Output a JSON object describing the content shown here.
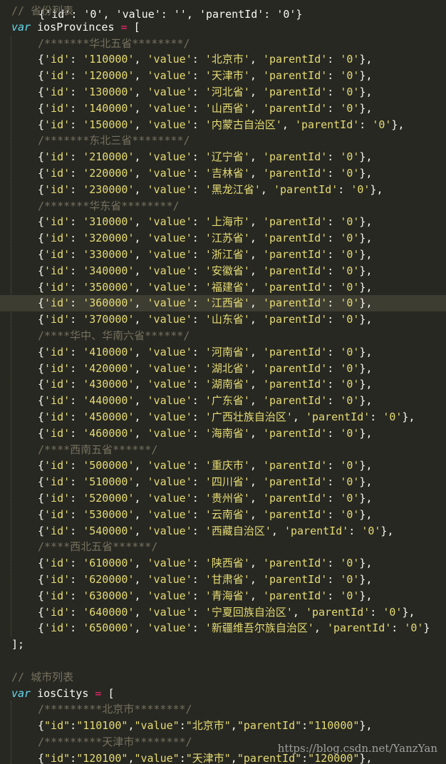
{
  "theme": {
    "background": "#272822",
    "comment": "#75715e",
    "keyword": "#66d9ef",
    "operator": "#f92672",
    "string": "#e6db74",
    "text": "#f8f8f2",
    "highlight_line": "#3e3d32"
  },
  "top_partial": "  {'id': '0', 'value': '', 'parentId': '0'}",
  "provinces_block": {
    "comment": "// 省份列表",
    "keyword": "var",
    "name": "iosProvinces",
    "opener": "= [",
    "groups": [
      {
        "comment": "/*******华北五省********/",
        "rows": [
          {
            "id": "110000",
            "value": "北京市"
          },
          {
            "id": "120000",
            "value": "天津市"
          },
          {
            "id": "130000",
            "value": "河北省"
          },
          {
            "id": "140000",
            "value": "山西省"
          },
          {
            "id": "150000",
            "value": "内蒙古自治区"
          }
        ]
      },
      {
        "comment": "/*******东北三省********/",
        "rows": [
          {
            "id": "210000",
            "value": "辽宁省"
          },
          {
            "id": "220000",
            "value": "吉林省"
          },
          {
            "id": "230000",
            "value": "黑龙江省"
          }
        ]
      },
      {
        "comment": "/*******华东省********/",
        "rows": [
          {
            "id": "310000",
            "value": "上海市"
          },
          {
            "id": "320000",
            "value": "江苏省"
          },
          {
            "id": "330000",
            "value": "浙江省"
          },
          {
            "id": "340000",
            "value": "安徽省"
          },
          {
            "id": "350000",
            "value": "福建省"
          },
          {
            "id": "360000",
            "value": "江西省",
            "highlight": true
          },
          {
            "id": "370000",
            "value": "山东省"
          }
        ]
      },
      {
        "comment": "/****华中、华南六省******/",
        "rows": [
          {
            "id": "410000",
            "value": "河南省"
          },
          {
            "id": "420000",
            "value": "湖北省"
          },
          {
            "id": "430000",
            "value": "湖南省"
          },
          {
            "id": "440000",
            "value": "广东省"
          },
          {
            "id": "450000",
            "value": "广西壮族自治区"
          },
          {
            "id": "460000",
            "value": "海南省"
          }
        ]
      },
      {
        "comment": "/****西南五省******/",
        "rows": [
          {
            "id": "500000",
            "value": "重庆市"
          },
          {
            "id": "510000",
            "value": "四川省"
          },
          {
            "id": "520000",
            "value": "贵州省"
          },
          {
            "id": "530000",
            "value": "云南省"
          },
          {
            "id": "540000",
            "value": "西藏自治区"
          }
        ]
      },
      {
        "comment": "/****西北五省******/",
        "rows": [
          {
            "id": "610000",
            "value": "陕西省"
          },
          {
            "id": "620000",
            "value": "甘肃省"
          },
          {
            "id": "630000",
            "value": "青海省"
          },
          {
            "id": "640000",
            "value": "宁夏回族自治区"
          },
          {
            "id": "650000",
            "value": "新疆维吾尔族自治区",
            "last": true
          }
        ]
      }
    ],
    "row_parent": "0",
    "closer": "];"
  },
  "cities_block": {
    "comment": "// 城市列表",
    "keyword": "var",
    "name": "iosCitys",
    "opener": "= [",
    "groups": [
      {
        "comment": "/*********北京市********/",
        "rows": [
          {
            "id": "110100",
            "value": "北京市",
            "parentId": "110000"
          }
        ]
      },
      {
        "comment": "/*********天津市********/",
        "rows": [
          {
            "id": "120100",
            "value": "天津市",
            "parentId": "120000"
          }
        ]
      }
    ]
  },
  "watermark": "https://blog.csdn.net/YanzYan"
}
